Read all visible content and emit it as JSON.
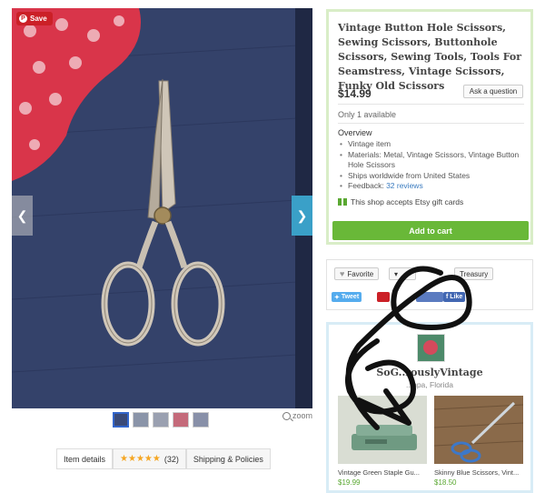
{
  "photo": {
    "save_label": "Save",
    "pin_glyph": "P",
    "prev_glyph": "❮",
    "next_glyph": "❯",
    "zoom_label": "zoom"
  },
  "tabs": {
    "item_details": "Item details",
    "stars": "★★★★★",
    "review_count": "(32)",
    "shipping": "Shipping & Policies"
  },
  "product": {
    "title": "Vintage Button Hole Scissors, Sewing Scissors, Buttonhole Scissors, Sewing Tools, Tools For Seamstress, Vintage Scissors, Funky Old Scissors",
    "price": "$14.99",
    "ask_label": "Ask a question",
    "availability": "Only 1 available",
    "overview_title": "Overview",
    "overview": {
      "item1": "Vintage item",
      "item2": "Materials: Metal, Vintage Scissors, Vintage Button Hole Scissors",
      "item3": "Ships worldwide from United States",
      "feedback_prefix": "Feedback: ",
      "feedback_link": "32 reviews"
    },
    "gift_text": "This shop accepts Etsy gift cards",
    "cart_label": "Add to cart"
  },
  "social": {
    "favorite_label": "Favorite",
    "treasury_label": "Treasury",
    "tweet_label": "Tweet",
    "like_label": "Like"
  },
  "shop": {
    "name": "SoG..rouslyVintage",
    "location": "..mpa, Florida",
    "listings": [
      {
        "name": "Vintage Green Staple Gu...",
        "price": "$19.99"
      },
      {
        "name": "Skinny Blue Scissors, Vint...",
        "price": "$18.50"
      }
    ]
  },
  "colors": {
    "accent_green": "#69b838",
    "panel_green_border": "#d9edc7",
    "panel_blue_border": "#d8ecf6",
    "link_blue": "#3a7bbf",
    "save_red": "#cb2027"
  }
}
